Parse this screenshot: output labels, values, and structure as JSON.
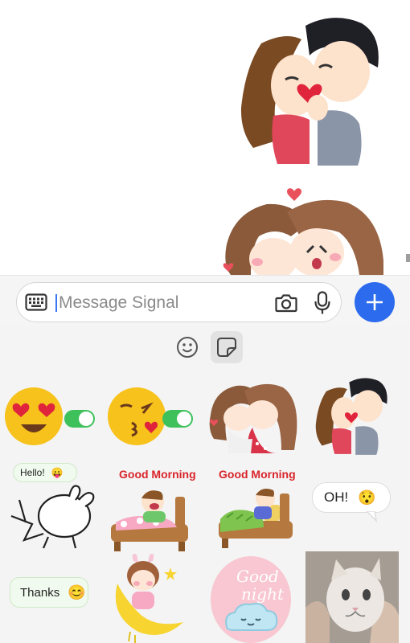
{
  "composer": {
    "placeholder": "Message Signal"
  },
  "icons": {
    "keyboard": "keyboard-icon",
    "camera": "camera-icon",
    "microphone": "microphone-icon",
    "send": "plus-icon",
    "emoji_tab": "smiley-icon",
    "sticker_tab": "sticker-icon"
  },
  "stickers": {
    "hello_label": "Hello!",
    "good_morning_1": "Good Morning",
    "good_morning_2": "Good Morning",
    "oh_label": "OH!",
    "thanks_label": "Thanks",
    "good_night_1": "Good",
    "good_night_2": "night"
  },
  "colors": {
    "accent": "#2c6bed",
    "caret": "#3a76f0",
    "toggle_on": "#3ec15b"
  }
}
